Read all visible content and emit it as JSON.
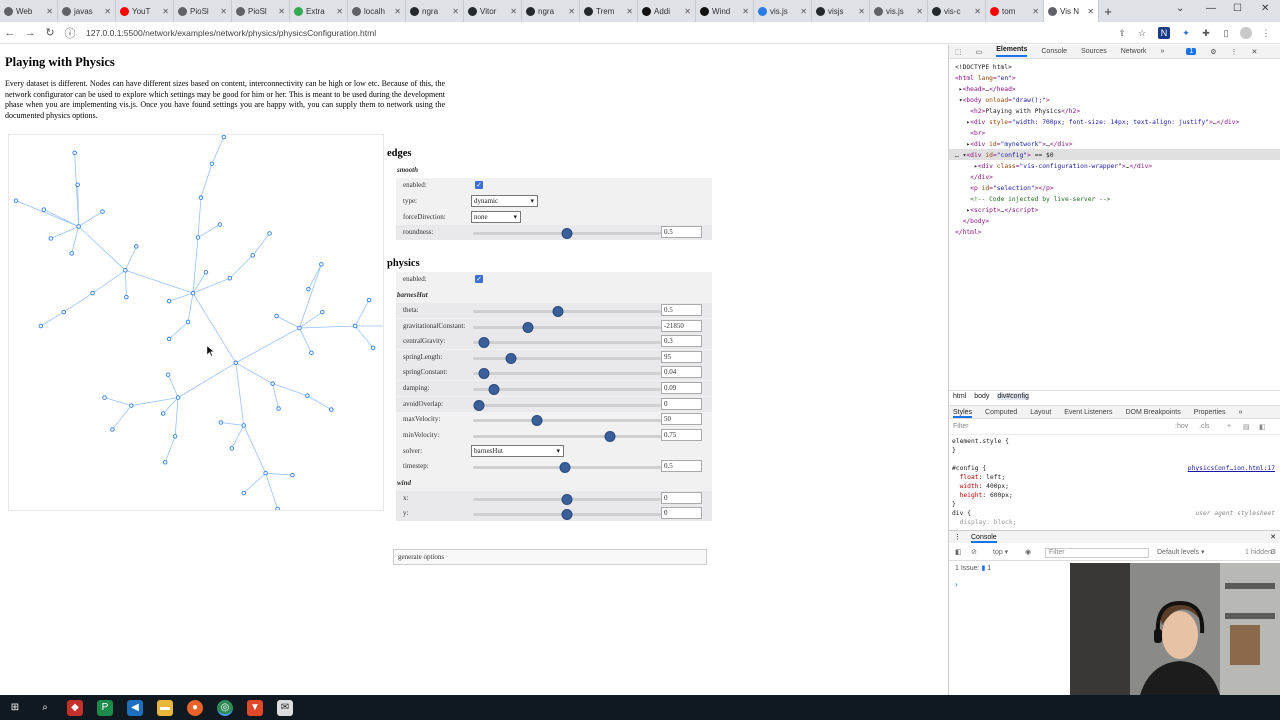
{
  "browser": {
    "tabs": [
      {
        "label": "Web",
        "color": "#5f6368"
      },
      {
        "label": "javas",
        "color": "#5f6368"
      },
      {
        "label": "YouT",
        "color": "#ff0000"
      },
      {
        "label": "PioSl",
        "color": "#5f6368"
      },
      {
        "label": "PioSl",
        "color": "#5f6368"
      },
      {
        "label": "Extra",
        "color": "#34a853"
      },
      {
        "label": "localh",
        "color": "#5f6368"
      },
      {
        "label": "ngra",
        "color": "#24292e"
      },
      {
        "label": "Vitor",
        "color": "#24292e"
      },
      {
        "label": "ngra",
        "color": "#24292e"
      },
      {
        "label": "Trem",
        "color": "#24292e"
      },
      {
        "label": "Addi",
        "color": "#111111"
      },
      {
        "label": "Wind",
        "color": "#111111"
      },
      {
        "label": "vis.js",
        "color": "#2b7ce9"
      },
      {
        "label": "visjs",
        "color": "#24292e"
      },
      {
        "label": "vis.js",
        "color": "#5f6368"
      },
      {
        "label": "vis-c",
        "color": "#24292e"
      },
      {
        "label": "tom",
        "color": "#ff0000"
      },
      {
        "label": "Vis N",
        "color": "#5f6368",
        "active": true
      }
    ],
    "new_tab": "+",
    "url": "127.0.0.1:5500/network/examples/network/physics/physicsConfiguration.html"
  },
  "page": {
    "title": "Playing with Physics",
    "intro": "Every dataset is different. Nodes can have different sizes based on content, interconnectivity can be high or low etc. Because of this, the network configurator can be used to explore which settings may be good for him or her. This is meant to be used during the development phase when you are implementing vis.js. Once you have found settings you are happy with, you can supply them to network using the documented physics options."
  },
  "config": {
    "edges": {
      "title": "edges",
      "smooth_title": "smooth",
      "enabled_label": "enabled:",
      "enabled": true,
      "type_label": "type:",
      "type_value": "dynamic",
      "forceDirection_label": "forceDirection:",
      "forceDirection_value": "none",
      "roundness_label": "roundness:",
      "roundness_value": "0.5",
      "roundness_pos": 0.5
    },
    "physics": {
      "title": "physics",
      "enabled_label": "enabled:",
      "enabled": true,
      "barnes_title": "barnesHut",
      "rows": [
        {
          "label": "theta:",
          "value": "0.5",
          "pos": 0.45
        },
        {
          "label": "gravitationalConstant:",
          "value": "-21850",
          "pos": 0.29
        },
        {
          "label": "centralGravity:",
          "value": "0.3",
          "pos": 0.06
        },
        {
          "label": "springLength:",
          "value": "95",
          "pos": 0.2
        },
        {
          "label": "springConstant:",
          "value": "0.04",
          "pos": 0.06
        },
        {
          "label": "damping:",
          "value": "0.09",
          "pos": 0.11
        },
        {
          "label": "avoidOverlap:",
          "value": "0",
          "pos": 0.03
        }
      ],
      "maxVelocity": {
        "label": "maxVelocity:",
        "value": "50",
        "pos": 0.34
      },
      "minVelocity": {
        "label": "minVelocity:",
        "value": "0.75",
        "pos": 0.73
      },
      "solver_label": "solver:",
      "solver_value": "barnesHut",
      "timestep": {
        "label": "timestep:",
        "value": "0.5",
        "pos": 0.49
      },
      "wind_title": "wind",
      "wind_x": {
        "label": "x:",
        "value": "0",
        "pos": 0.5
      },
      "wind_y": {
        "label": "y:",
        "value": "0",
        "pos": 0.5
      }
    },
    "generate_label": "generate options"
  },
  "devtools": {
    "tabs": [
      "Elements",
      "Console",
      "Sources",
      "Network",
      "»"
    ],
    "active_tab": "Elements",
    "issue_badge": "1",
    "breadcrumbs": [
      "html",
      "body",
      "div#config"
    ],
    "style_tabs": [
      "Styles",
      "Computed",
      "Layout",
      "Event Listeners",
      "DOM Breakpoints",
      "Properties",
      "»"
    ],
    "filter_placeholder": "Filter",
    "filter_hov": ":hov",
    "filter_cls": ".cls",
    "console_title": "Console",
    "console_context": "top",
    "console_filter": "Filter",
    "console_levels": "Default levels",
    "console_hidden": "1 hidden",
    "issues_text": "1 Issue:",
    "issues_count": "1",
    "prompt": "›",
    "css": {
      "element_style": "element.style {",
      "config_sel": "#config {",
      "config_src": "physicsConf…ion.html:17",
      "p1": "float",
      "v1": "left;",
      "p2": "width",
      "v2": "400px;",
      "p3": "height",
      "v3": "600px;",
      "div_sel": "div {",
      "div_src": "user agent stylesheet",
      "div_p": "display: block;"
    }
  }
}
